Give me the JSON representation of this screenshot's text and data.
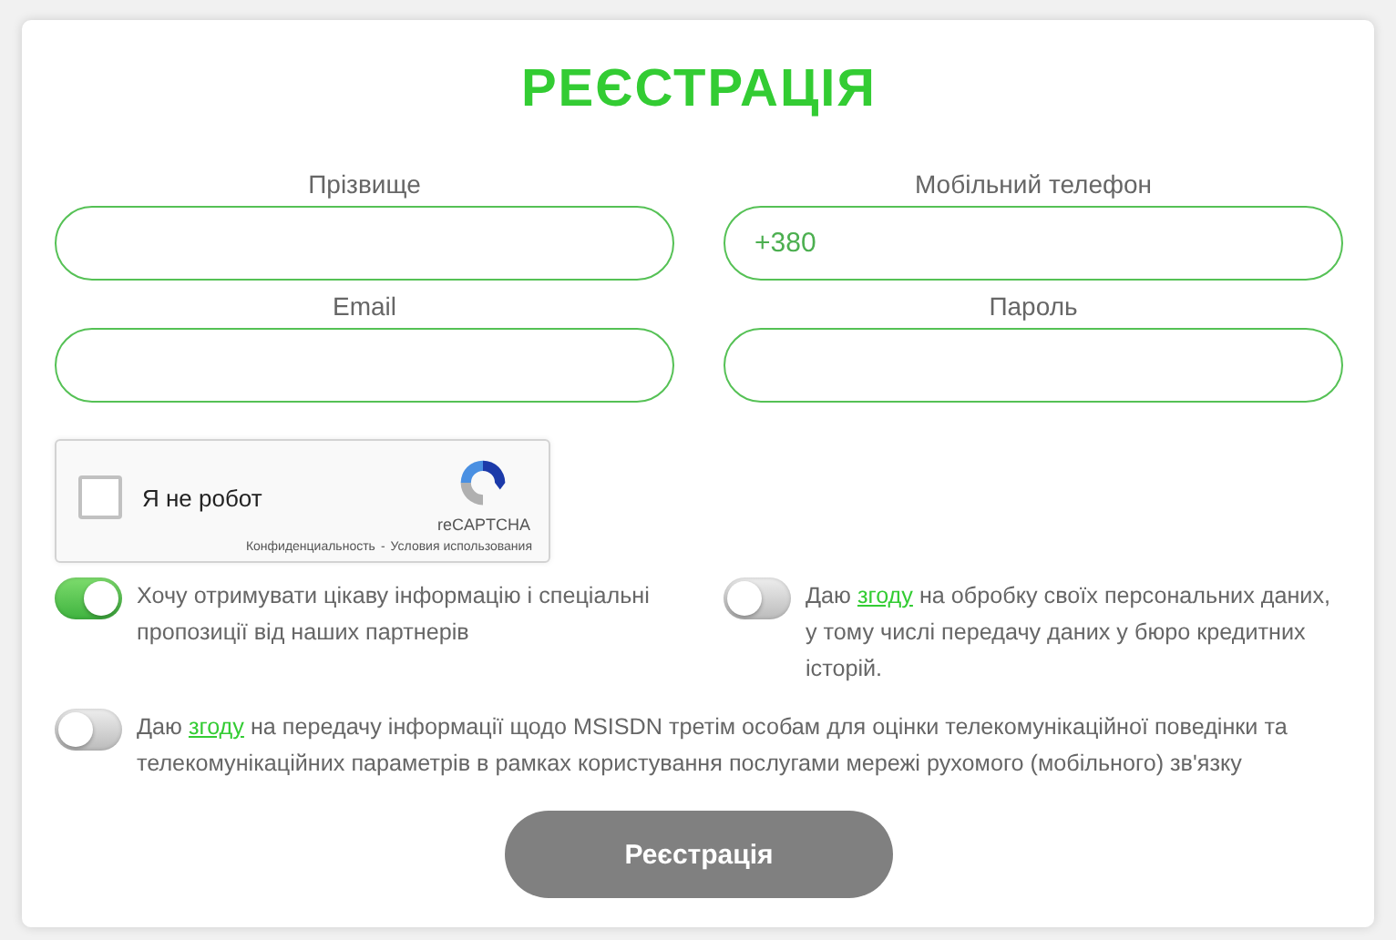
{
  "title": "РЕЄСТРАЦІЯ",
  "fields": [
    {
      "label": "Прізвище"
    },
    {
      "label": "Мобільний телефон",
      "value": "+380"
    },
    {
      "label": "Email"
    },
    {
      "label": "Пароль"
    }
  ],
  "captcha": {
    "checked": false,
    "label": "Я не робот",
    "brand": "reCAPTCHA",
    "privacy": "Конфиденциальность",
    "separator": "-",
    "terms": "Условия использования"
  },
  "consents": [
    {
      "on": true,
      "before": "Хочу отримувати цікаву інформацію і спеціальні пропозиції від наших партнерів"
    },
    {
      "on": false,
      "before": "Даю ",
      "link": "згоду",
      "after": " на обробку своїх персональних даних, у тому числі передачу даних у бюро кредитних історій."
    },
    {
      "on": false,
      "before": "Даю ",
      "link": "згоду",
      "after": " на передачу інформації щодо MSISDN третім особам для оцінки телекомунікаційної поведінки та телекомунікаційних параметрів в рамках користування послугами мережі рухомого (мобільного) зв'язку"
    }
  ],
  "submit": "Реєстрація"
}
